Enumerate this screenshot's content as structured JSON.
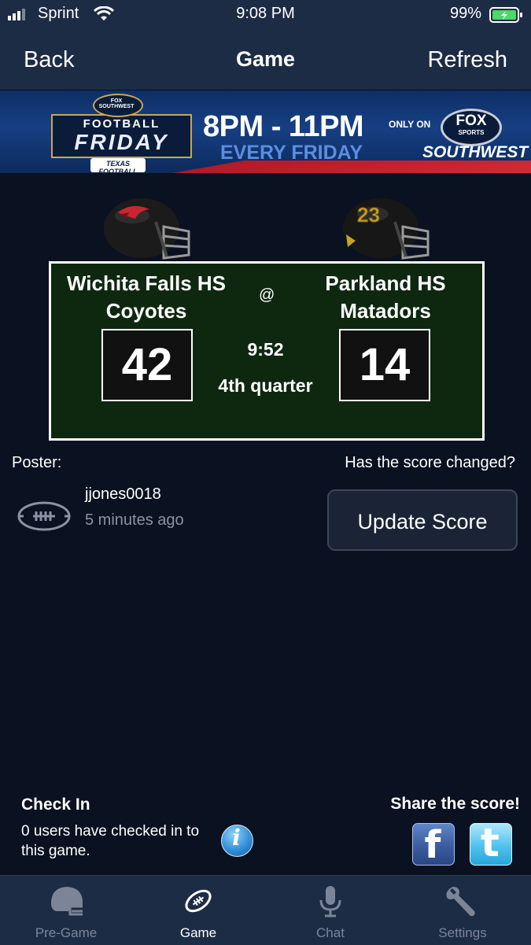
{
  "status_bar": {
    "carrier": "Sprint",
    "time": "9:08 PM",
    "battery": "99%"
  },
  "nav": {
    "back_label": "Back",
    "title": "Game",
    "refresh_label": "Refresh"
  },
  "banner": {
    "brand_top": "FOX SOUTHWEST",
    "football": "FOOTBALL",
    "friday": "FRIDAY",
    "presented": "TEXAS FOOTBALL",
    "time": "8PM - 11PM",
    "every": "EVERY FRIDAY",
    "only_on": "ONLY ON",
    "fox": "FOX",
    "sports": "SPORTS",
    "southwest": "SOUTHWEST"
  },
  "game": {
    "home": {
      "school": "Wichita Falls HS",
      "mascot": "Coyotes",
      "score": "42"
    },
    "away": {
      "school": "Parkland HS",
      "mascot": "Matadors",
      "score": "14",
      "helmet_number": "23"
    },
    "at": "@",
    "clock": "9:52",
    "period": "4th quarter"
  },
  "poster": {
    "label": "Poster:",
    "username": "jjones0018",
    "time_ago": "5 minutes ago"
  },
  "score_prompt": "Has the score changed?",
  "update_button": "Update Score",
  "checkin": {
    "title": "Check In",
    "text": "0 users have checked in to this game."
  },
  "share": {
    "title": "Share the score!"
  },
  "tabs": [
    {
      "label": "Pre-Game",
      "icon": "helmet-icon",
      "active": false
    },
    {
      "label": "Game",
      "icon": "football-icon",
      "active": true
    },
    {
      "label": "Chat",
      "icon": "microphone-icon",
      "active": false
    },
    {
      "label": "Settings",
      "icon": "wrench-icon",
      "active": false
    }
  ],
  "colors": {
    "background": "#0a1120",
    "bar": "#1d2c45",
    "board": "#0e2810",
    "inactive_tab": "#7c8597"
  }
}
